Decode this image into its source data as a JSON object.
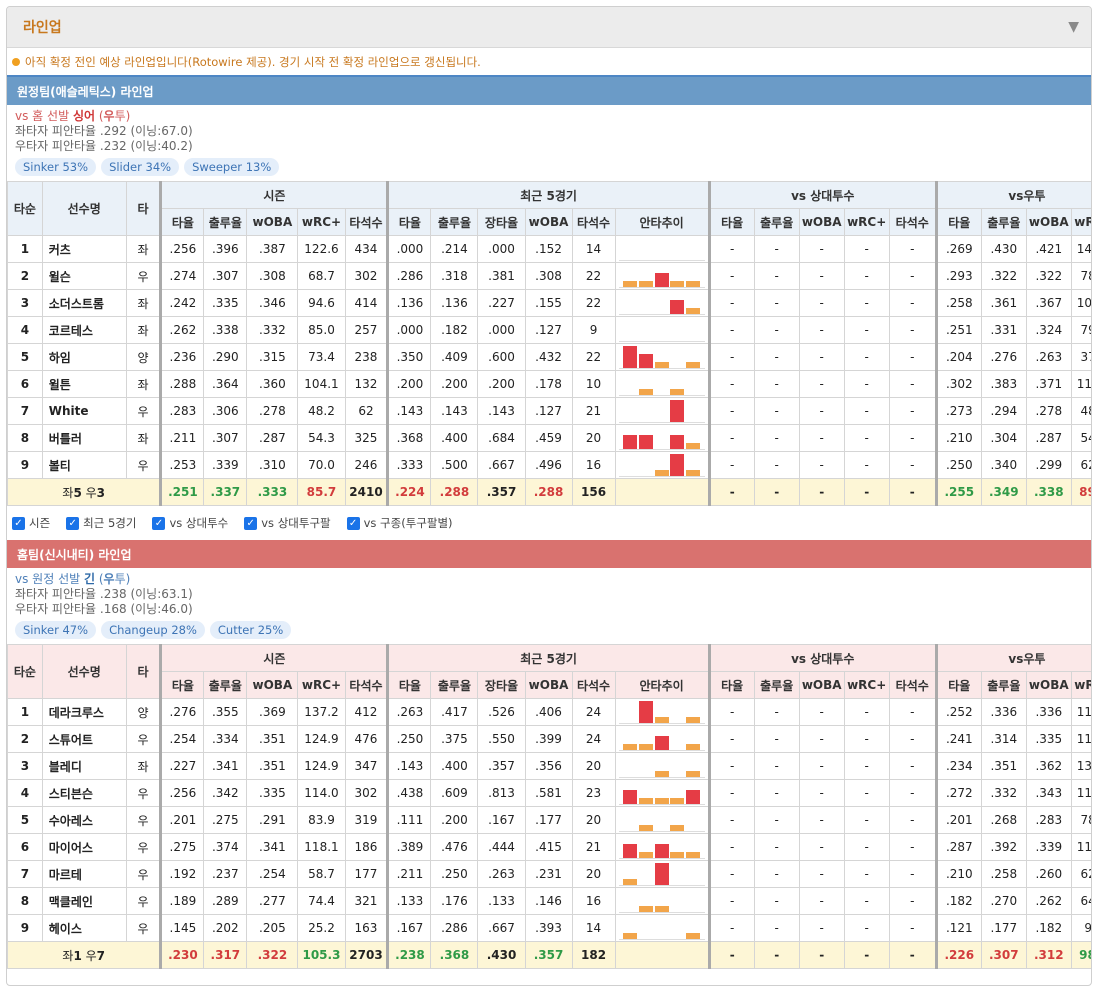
{
  "panel": {
    "title": "라인업"
  },
  "notice": "아직 확정 전인 예상 라인업입니다(Rotowire 제공). 경기 시작 전 확정 라인업으로 갱신됩니다.",
  "colors": {
    "orange_bar": "#f2a54a",
    "red_bar": "#e53c45",
    "away_header": "#6b9bc7",
    "home_header": "#d9726f"
  },
  "headers": {
    "order": "타순",
    "player": "선수명",
    "hand": "타",
    "group_season": "시즌",
    "group_recent": "최근 5경기",
    "group_vs_pitcher": "vs 상대투수",
    "group_vs_hand": "vs우투",
    "season_cols": [
      "타율",
      "출루율",
      "wOBA",
      "wRC+",
      "타석수"
    ],
    "recent_cols": [
      "타율",
      "출루율",
      "장타율",
      "wOBA",
      "타석수",
      "안타추이"
    ],
    "vsp_cols": [
      "타율",
      "출루율",
      "wOBA",
      "wRC+",
      "타석수"
    ],
    "vsh_cols": [
      "타율",
      "출루율",
      "wOBA",
      "wRC+"
    ]
  },
  "filters": [
    "시즌",
    "최근 5경기",
    "vs 상대투수",
    "vs 상대투구팔",
    "vs 구종(투구팔별)"
  ],
  "away": {
    "title": "원정팀(애슬레틱스) 라인업",
    "pitcher": {
      "prefix": "vs 홈 선발",
      "name": "싱어",
      "hand_open": "(",
      "hand": "우",
      "hand_close": "투)",
      "lhb": "좌타자 피안타율 .292 (이닝:67.0)",
      "rhb": "우타자 피안타율 .232 (이닝:40.2)"
    },
    "pitches": [
      "Sinker 53%",
      "Slider 34%",
      "Sweeper 13%"
    ],
    "rows": [
      {
        "order": "1",
        "name": "커츠",
        "hand": "좌",
        "season": [
          ".256",
          ".396",
          ".387",
          "122.6",
          "434"
        ],
        "recent": [
          ".000",
          ".214",
          ".000",
          ".152",
          "14"
        ],
        "trend": [
          0,
          0,
          0,
          0,
          0
        ],
        "vsp": [
          "-",
          "-",
          "-",
          "-",
          "-"
        ],
        "vsh": [
          ".269",
          ".430",
          ".421",
          "145.8"
        ]
      },
      {
        "order": "2",
        "name": "윌슨",
        "hand": "우",
        "season": [
          ".274",
          ".307",
          ".308",
          "68.7",
          "302"
        ],
        "recent": [
          ".286",
          ".318",
          ".381",
          ".308",
          "22"
        ],
        "trend": [
          1,
          1,
          2,
          1,
          1
        ],
        "vsp": [
          "-",
          "-",
          "-",
          "-",
          "-"
        ],
        "vsh": [
          ".293",
          ".322",
          ".322",
          "78.2"
        ]
      },
      {
        "order": "3",
        "name": "소더스트롬",
        "hand": "좌",
        "season": [
          ".242",
          ".335",
          ".346",
          "94.6",
          "414"
        ],
        "recent": [
          ".136",
          ".136",
          ".227",
          ".155",
          "22"
        ],
        "trend": [
          0,
          0,
          0,
          2,
          1
        ],
        "vsp": [
          "-",
          "-",
          "-",
          "-",
          "-"
        ],
        "vsh": [
          ".258",
          ".361",
          ".367",
          "108.9"
        ]
      },
      {
        "order": "4",
        "name": "코르테스",
        "hand": "좌",
        "season": [
          ".262",
          ".338",
          ".332",
          "85.0",
          "257"
        ],
        "recent": [
          ".000",
          ".182",
          ".000",
          ".127",
          "9"
        ],
        "trend": [
          0,
          0,
          0,
          0,
          0
        ],
        "vsp": [
          "-",
          "-",
          "-",
          "-",
          "-"
        ],
        "vsh": [
          ".251",
          ".331",
          ".324",
          "79.6"
        ]
      },
      {
        "order": "5",
        "name": "하임",
        "hand": "양",
        "season": [
          ".236",
          ".290",
          ".315",
          "73.4",
          "238"
        ],
        "recent": [
          ".350",
          ".409",
          ".600",
          ".432",
          "22"
        ],
        "trend": [
          3,
          2,
          1,
          0,
          1
        ],
        "vsp": [
          "-",
          "-",
          "-",
          "-",
          "-"
        ],
        "vsh": [
          ".204",
          ".276",
          ".263",
          "37.9"
        ]
      },
      {
        "order": "6",
        "name": "윌튼",
        "hand": "좌",
        "season": [
          ".288",
          ".364",
          ".360",
          "104.1",
          "132"
        ],
        "recent": [
          ".200",
          ".200",
          ".200",
          ".178",
          "10"
        ],
        "trend": [
          0,
          1,
          0,
          1,
          0
        ],
        "vsp": [
          "-",
          "-",
          "-",
          "-",
          "-"
        ],
        "vsh": [
          ".302",
          ".383",
          ".371",
          "111.7"
        ]
      },
      {
        "order": "7",
        "name": "White",
        "hand": "우",
        "season": [
          ".283",
          ".306",
          ".278",
          "48.2",
          "62"
        ],
        "recent": [
          ".143",
          ".143",
          ".143",
          ".127",
          "21"
        ],
        "trend": [
          0,
          0,
          0,
          3,
          0
        ],
        "vsp": [
          "-",
          "-",
          "-",
          "-",
          "-"
        ],
        "vsh": [
          ".273",
          ".294",
          ".278",
          "48.2"
        ]
      },
      {
        "order": "8",
        "name": "버틀러",
        "hand": "좌",
        "season": [
          ".211",
          ".307",
          ".287",
          "54.3",
          "325"
        ],
        "recent": [
          ".368",
          ".400",
          ".684",
          ".459",
          "20"
        ],
        "trend": [
          2,
          2,
          0,
          2,
          1
        ],
        "vsp": [
          "-",
          "-",
          "-",
          "-",
          "-"
        ],
        "vsh": [
          ".210",
          ".304",
          ".287",
          "54.3"
        ]
      },
      {
        "order": "9",
        "name": "볼티",
        "hand": "우",
        "season": [
          ".253",
          ".339",
          ".310",
          "70.0",
          "246"
        ],
        "recent": [
          ".333",
          ".500",
          ".667",
          ".496",
          "16"
        ],
        "trend": [
          0,
          0,
          1,
          3,
          1
        ],
        "vsp": [
          "-",
          "-",
          "-",
          "-",
          "-"
        ],
        "vsh": [
          ".250",
          ".340",
          ".299",
          "62.5"
        ]
      }
    ],
    "summary": {
      "left_prefix": "좌",
      "left": "5",
      "right_prefix": " 우",
      "right": "3",
      "season": [
        ".251",
        ".337",
        ".333",
        "85.7",
        "2410"
      ],
      "season_colors": [
        "green",
        "green",
        "green",
        "red",
        "plain"
      ],
      "recent": [
        ".224",
        ".288",
        ".357",
        ".288",
        "156"
      ],
      "recent_colors": [
        "red",
        "red",
        "black",
        "red",
        "plain"
      ],
      "vsp": [
        "-",
        "-",
        "-",
        "-",
        "-"
      ],
      "vsh": [
        ".255",
        ".349",
        ".338",
        "89.4"
      ],
      "vsh_colors": [
        "green",
        "green",
        "green",
        "red"
      ]
    }
  },
  "home": {
    "title": "홈팀(신시내티) 라인업",
    "pitcher": {
      "prefix": "vs 원정 선발",
      "name": "긴",
      "hand_open": "(",
      "hand": "우",
      "hand_close": "투)",
      "lhb": "좌타자 피안타율 .238 (이닝:63.1)",
      "rhb": "우타자 피안타율 .168 (이닝:46.0)"
    },
    "pitches": [
      "Sinker 47%",
      "Changeup 28%",
      "Cutter 25%"
    ],
    "rows": [
      {
        "order": "1",
        "name": "데라크루스",
        "hand": "양",
        "season": [
          ".276",
          ".355",
          ".369",
          "137.2",
          "412"
        ],
        "recent": [
          ".263",
          ".417",
          ".526",
          ".406",
          "24"
        ],
        "trend": [
          0,
          3,
          1,
          0,
          1
        ],
        "vsp": [
          "-",
          "-",
          "-",
          "-",
          "-"
        ],
        "vsh": [
          ".252",
          ".336",
          ".336",
          "114.7"
        ]
      },
      {
        "order": "2",
        "name": "스튜어트",
        "hand": "우",
        "season": [
          ".254",
          ".334",
          ".351",
          "124.9",
          "476"
        ],
        "recent": [
          ".250",
          ".375",
          ".550",
          ".399",
          "24"
        ],
        "trend": [
          1,
          1,
          2,
          0,
          1
        ],
        "vsp": [
          "-",
          "-",
          "-",
          "-",
          "-"
        ],
        "vsh": [
          ".241",
          ".314",
          ".335",
          "114.0"
        ]
      },
      {
        "order": "3",
        "name": "블레디",
        "hand": "좌",
        "season": [
          ".227",
          ".341",
          ".351",
          "124.9",
          "347"
        ],
        "recent": [
          ".143",
          ".400",
          ".357",
          ".356",
          "20"
        ],
        "trend": [
          0,
          0,
          1,
          0,
          1
        ],
        "vsp": [
          "-",
          "-",
          "-",
          "-",
          "-"
        ],
        "vsh": [
          ".234",
          ".351",
          ".362",
          "132.4"
        ]
      },
      {
        "order": "4",
        "name": "스티븐슨",
        "hand": "우",
        "season": [
          ".256",
          ".342",
          ".335",
          "114.0",
          "302"
        ],
        "recent": [
          ".438",
          ".609",
          ".813",
          ".581",
          "23"
        ],
        "trend": [
          2,
          1,
          1,
          1,
          2
        ],
        "vsp": [
          "-",
          "-",
          "-",
          "-",
          "-"
        ],
        "vsh": [
          ".272",
          ".332",
          ".343",
          "119.4"
        ]
      },
      {
        "order": "5",
        "name": "수아레스",
        "hand": "우",
        "season": [
          ".201",
          ".275",
          ".291",
          "83.9",
          "319"
        ],
        "recent": [
          ".111",
          ".200",
          ".167",
          ".177",
          "20"
        ],
        "trend": [
          0,
          1,
          0,
          1,
          0
        ],
        "vsp": [
          "-",
          "-",
          "-",
          "-",
          "-"
        ],
        "vsh": [
          ".201",
          ".268",
          ".283",
          "78.5"
        ]
      },
      {
        "order": "6",
        "name": "마이어스",
        "hand": "우",
        "season": [
          ".275",
          ".374",
          ".341",
          "118.1",
          "186"
        ],
        "recent": [
          ".389",
          ".476",
          ".444",
          ".415",
          "21"
        ],
        "trend": [
          2,
          1,
          2,
          1,
          1
        ],
        "vsp": [
          "-",
          "-",
          "-",
          "-",
          "-"
        ],
        "vsh": [
          ".287",
          ".392",
          ".339",
          "116.7"
        ]
      },
      {
        "order": "7",
        "name": "마르테",
        "hand": "우",
        "season": [
          ".192",
          ".237",
          ".254",
          "58.7",
          "177"
        ],
        "recent": [
          ".211",
          ".250",
          ".263",
          ".231",
          "20"
        ],
        "trend": [
          1,
          0,
          3,
          0,
          0
        ],
        "vsp": [
          "-",
          "-",
          "-",
          "-",
          "-"
        ],
        "vsh": [
          ".210",
          ".258",
          ".260",
          "62.8"
        ]
      },
      {
        "order": "8",
        "name": "맥클레인",
        "hand": "우",
        "season": [
          ".189",
          ".289",
          ".277",
          "74.4",
          "321"
        ],
        "recent": [
          ".133",
          ".176",
          ".133",
          ".146",
          "16"
        ],
        "trend": [
          0,
          1,
          1,
          0,
          0
        ],
        "vsp": [
          "-",
          "-",
          "-",
          "-",
          "-"
        ],
        "vsh": [
          ".182",
          ".270",
          ".262",
          "64.1"
        ]
      },
      {
        "order": "9",
        "name": "헤이스",
        "hand": "우",
        "season": [
          ".145",
          ".202",
          ".205",
          "25.2",
          "163"
        ],
        "recent": [
          ".167",
          ".286",
          ".667",
          ".393",
          "14"
        ],
        "trend": [
          1,
          0,
          0,
          0,
          1
        ],
        "vsp": [
          "-",
          "-",
          "-",
          "-",
          "-"
        ],
        "vsh": [
          ".121",
          ".177",
          ".182",
          "9.5"
        ]
      }
    ],
    "summary": {
      "left_prefix": "좌",
      "left": "1",
      "right_prefix": " 우",
      "right": "7",
      "season": [
        ".230",
        ".317",
        ".322",
        "105.3",
        "2703"
      ],
      "season_colors": [
        "red",
        "red",
        "red",
        "green",
        "plain"
      ],
      "recent": [
        ".238",
        ".368",
        ".430",
        ".357",
        "182"
      ],
      "recent_colors": [
        "green",
        "green",
        "black",
        "green",
        "plain"
      ],
      "vsp": [
        "-",
        "-",
        "-",
        "-",
        "-"
      ],
      "vsh": [
        ".226",
        ".307",
        ".312",
        "98.3"
      ],
      "vsh_colors": [
        "red",
        "red",
        "red",
        "green"
      ]
    }
  }
}
